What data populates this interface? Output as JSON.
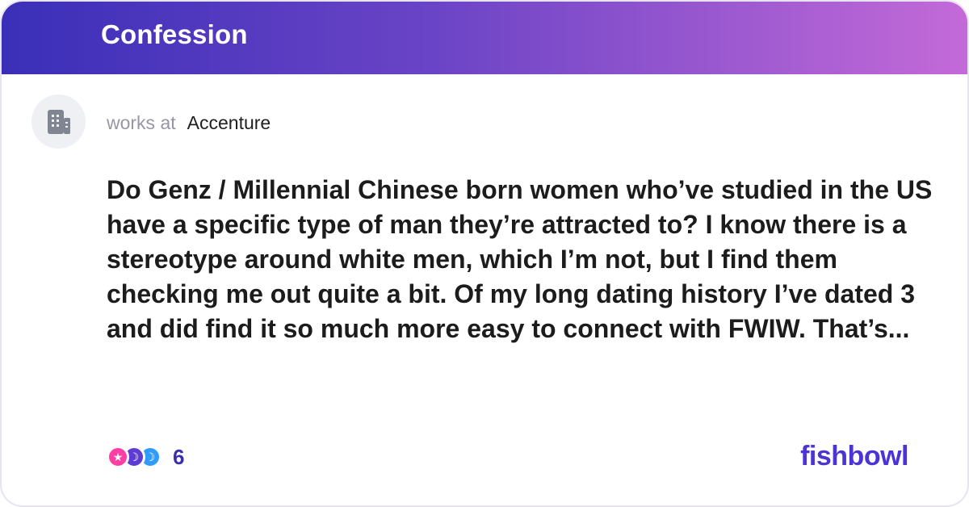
{
  "header": {
    "title": "Confession"
  },
  "author": {
    "works_at_label": "works at",
    "company": "Accenture",
    "avatar_icon": "building-icon"
  },
  "post": {
    "text": "Do Genz / Millennial Chinese born women who’ve studied in the US have a specific type of man they’re attracted to? I know there is a stereotype around white men, which I’m not, but I find them checking me out quite a bit. Of my long dating history I’ve dated 3 and did find it so much more easy to connect with FWIW. That’s..."
  },
  "reactions": {
    "count": "6",
    "icons": [
      "star-reaction-icon",
      "moon-reaction-icon",
      "moon-reaction-icon"
    ]
  },
  "brand": {
    "name": "fishbowl"
  },
  "colors": {
    "header_start": "#3a2fb8",
    "header_end": "#c46ad8",
    "brand": "#4b34d6",
    "accent_count": "#3b2fb0"
  }
}
